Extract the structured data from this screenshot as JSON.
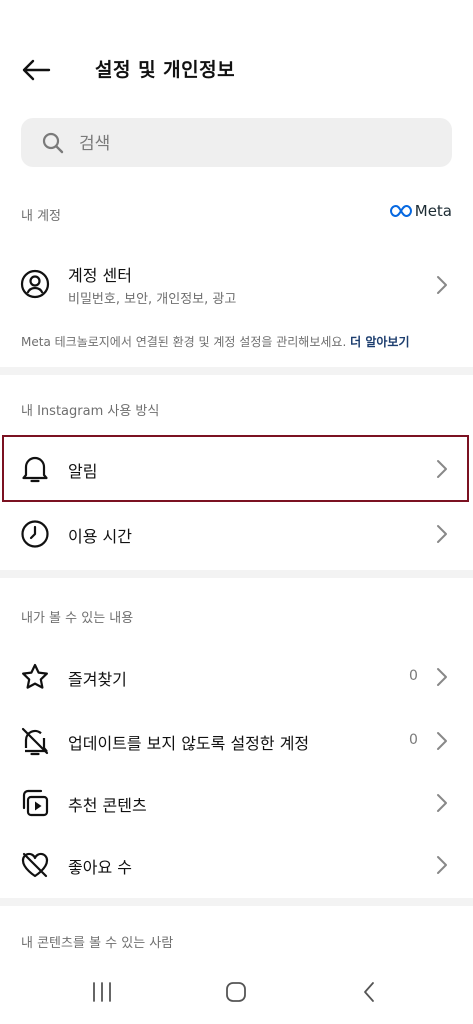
{
  "header": {
    "title": "설정 및 개인정보"
  },
  "search": {
    "placeholder": "검색"
  },
  "account_section": {
    "label": "내 계정",
    "brand": "Meta",
    "item": {
      "label": "계정 센터",
      "subtitle": "비밀번호, 보안, 개인정보, 광고"
    },
    "info_text": "Meta 테크놀로지에서 연결된 환경 및 계정 설정을 관리해보세요.",
    "info_link": "더 알아보기"
  },
  "usage_section": {
    "label": "내 Instagram 사용 방식",
    "items": [
      {
        "label": "알림",
        "icon": "bell-icon",
        "highlighted": true
      },
      {
        "label": "이용 시간",
        "icon": "clock-icon"
      }
    ]
  },
  "content_section": {
    "label": "내가 볼 수 있는 내용",
    "items": [
      {
        "label": "즐겨찾기",
        "icon": "star-icon",
        "count": "0"
      },
      {
        "label": "업데이트를 보지 않도록 설정한 계정",
        "icon": "muted-bell-icon",
        "count": "0"
      },
      {
        "label": "추천 콘텐츠",
        "icon": "suggested-content-icon"
      },
      {
        "label": "좋아요 수",
        "icon": "heart-off-icon"
      }
    ]
  },
  "who_section": {
    "label": "내 콘텐츠를 볼 수 있는 사람"
  },
  "colors": {
    "highlight_border": "#7b1121",
    "link": "#1c3d6e",
    "meta_brand": "#0668e1"
  }
}
